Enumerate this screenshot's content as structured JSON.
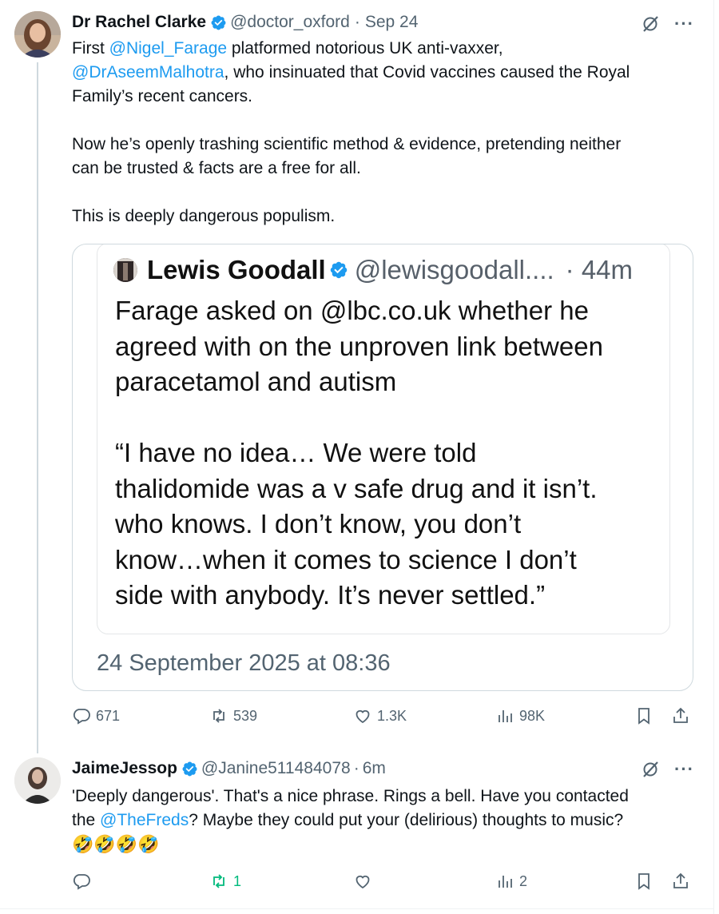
{
  "tweet": {
    "author_name": "Dr Rachel Clarke",
    "author_handle": "@doctor_oxford",
    "date": "Sep 24",
    "text": {
      "line1_pre": "First ",
      "mention1": "@Nigel_Farage",
      "line1_post": " platformed notorious UK anti-vaxxer,",
      "mention2": "@DrAseemMalhotra",
      "line2_post": ", who insinuated that Covid vaccines caused the Royal",
      "line3": "Family’s recent cancers.",
      "para2_line1": "Now he’s openly trashing scientific method & evidence, pretending neither",
      "para2_line2": "can be trusted & facts are a free for all.",
      "para3": "This is deeply dangerous populism."
    },
    "quote": {
      "author_name": "Lewis Goodall",
      "author_handle": "@lewisgoodall....",
      "time": "· 44m",
      "p1_line1": "Farage asked on @lbc.co.uk  whether he",
      "p1_line2": "agreed with on the unproven link between",
      "p1_line3": "paracetamol and autism",
      "p2_line1": "“I have no idea… We were told",
      "p2_line2": "thalidomide was a v safe drug and it isn’t.",
      "p2_line3": "who knows. I don’t know, you don’t",
      "p2_line4": "know…when it comes to science I don’t",
      "p2_line5": "side with anybody. It’s never settled.”",
      "timestamp": "24 September 2025 at 08:36"
    },
    "stats": {
      "replies": "671",
      "reposts": "539",
      "likes": "1.3K",
      "views": "98K"
    }
  },
  "reply": {
    "author_name": "JaimeJessop",
    "author_handle": "@Janine511484078",
    "time": "6m",
    "text": {
      "line1": "'Deeply dangerous'. That's a nice phrase. Rings a bell. Have you contacted",
      "line2_pre": "the ",
      "mention": "@TheFreds",
      "line2_post": "? Maybe they could put your (delirious) thoughts to music?",
      "emoji": "🤣🤣🤣🤣"
    },
    "stats": {
      "replies": "",
      "reposts": "1",
      "likes": "",
      "views": "2"
    }
  },
  "colors": {
    "accent": "#1d9bf0",
    "muted": "#536471",
    "repost_active": "#00ba7c"
  }
}
